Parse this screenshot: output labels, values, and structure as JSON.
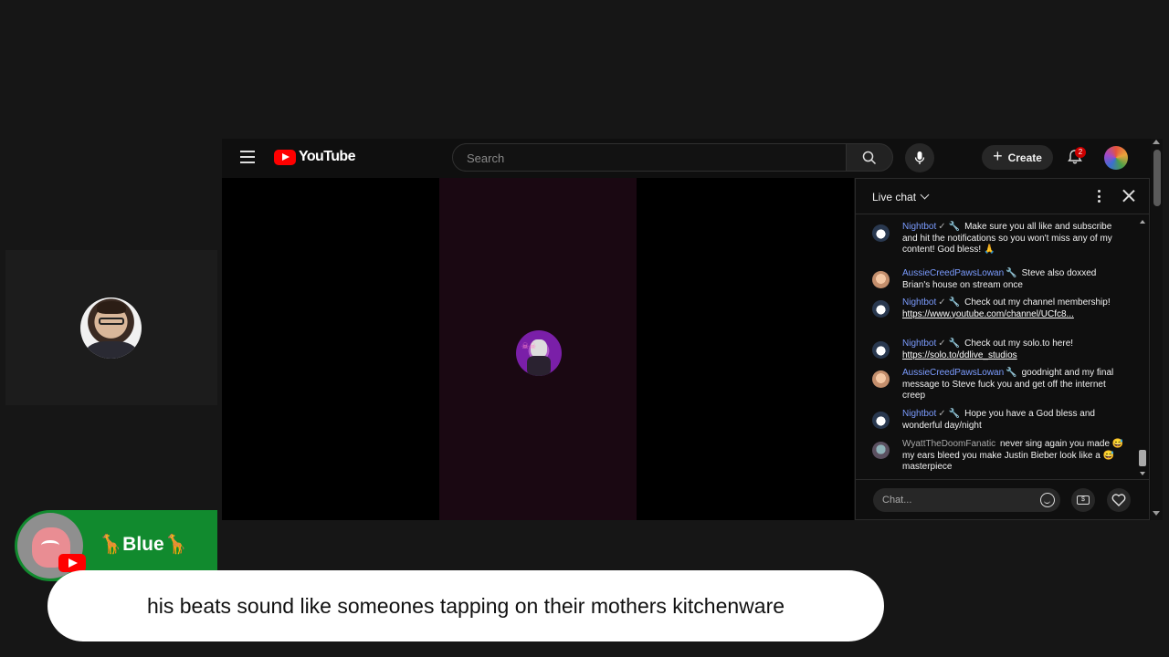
{
  "youtube": {
    "logo_text": "YouTube",
    "search_placeholder": "Search",
    "create_label": "Create",
    "notification_count": "2"
  },
  "chat": {
    "title": "Live chat",
    "input_placeholder": "Chat...",
    "messages": [
      {
        "author": "Nightbot",
        "verified": "✓",
        "text": "Make sure you all like and subscribe and hit the notifications so you won't miss any of my content! God bless! 🙏"
      },
      {
        "author": "AussieCreedPawsLowan",
        "text": "Steve also doxxed Brian's house on stream once"
      },
      {
        "author": "Nightbot",
        "verified": "✓",
        "text": "Check out my channel membership!",
        "link": "https://www.youtube.com/channel/UCfc8..."
      },
      {
        "author": "Nightbot",
        "verified": "✓",
        "text": "Check out my solo.to here!",
        "link": "https://solo.to/ddlive_studios"
      },
      {
        "author": "AussieCreedPawsLowan",
        "text": "goodnight and my final message to Steve fuck you and get off the internet creep"
      },
      {
        "author": "Nightbot",
        "verified": "✓",
        "text": "Hope you have a God bless and wonderful day/night"
      },
      {
        "author": "WyattTheDoomFanatic",
        "text": "never sing again you made 😅 my ears bleed you make Justin Bieber look like a 😅 masterpiece"
      }
    ]
  },
  "alert": {
    "name": "🦒Blue🦒"
  },
  "caption": {
    "text": "his beats sound like someones tapping on their mothers kitchenware"
  }
}
